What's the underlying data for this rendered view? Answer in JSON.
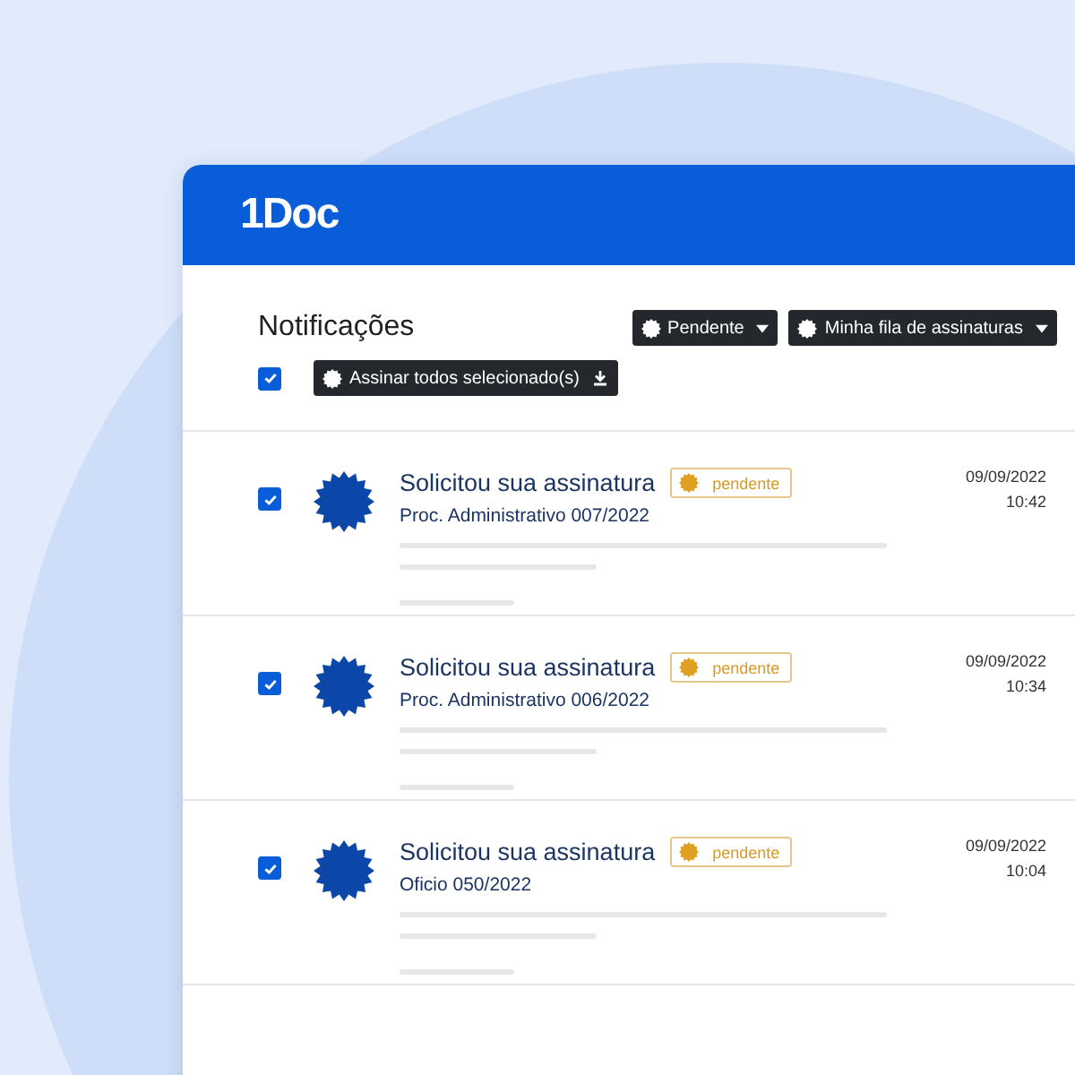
{
  "header": {
    "logo": "1Doc"
  },
  "toolbar": {
    "title": "Notificações",
    "filters": [
      {
        "label": "Pendente"
      },
      {
        "label": "Minha fila de assinaturas"
      }
    ],
    "select_all": {
      "checked": true
    },
    "sign_button": "Assinar todos selecionado(s)"
  },
  "notifications": [
    {
      "checked": true,
      "title": "Solicitou sua assinatura",
      "status": "pendente",
      "subtitle": "Proc. Administrativo 007/2022",
      "date": "09/09/2022",
      "time": "10:42"
    },
    {
      "checked": true,
      "title": "Solicitou sua assinatura",
      "status": "pendente",
      "subtitle": "Proc. Administrativo 006/2022",
      "date": "09/09/2022",
      "time": "10:34"
    },
    {
      "checked": true,
      "title": "Solicitou sua assinatura",
      "status": "pendente",
      "subtitle": "Oficio 050/2022",
      "date": "09/09/2022",
      "time": "10:04"
    }
  ]
}
